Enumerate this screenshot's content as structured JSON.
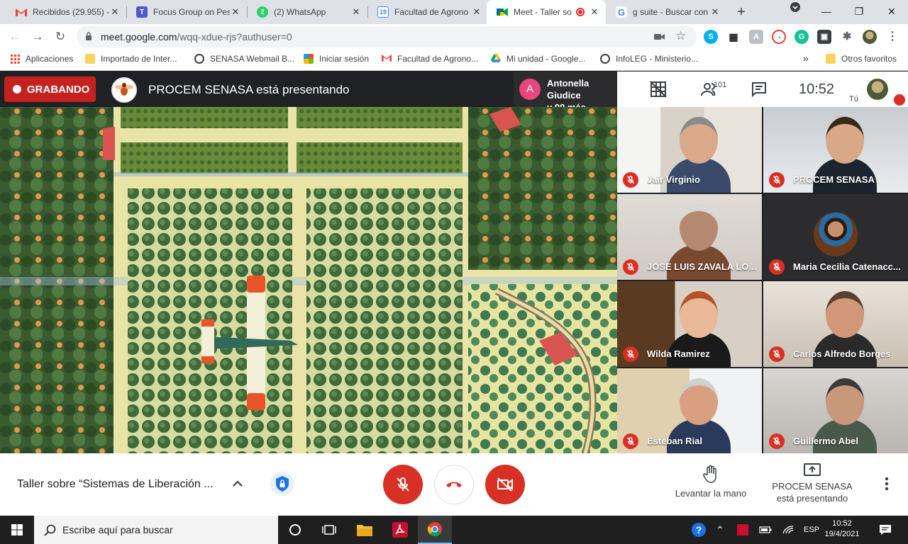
{
  "browser": {
    "tabs": [
      {
        "title": "Recibidos (29.955) - ",
        "icon": "gmail-icon"
      },
      {
        "title": "Focus Group on Pes",
        "icon": "teams-icon"
      },
      {
        "title": "(2) WhatsApp",
        "icon": "whatsapp-icon",
        "badge": "2"
      },
      {
        "title": "Facultad de Agrono",
        "icon": "calendar-icon",
        "badge": "19"
      },
      {
        "title": "Meet - Taller so",
        "icon": "meet-icon",
        "active": true
      },
      {
        "title": "g suite - Buscar con",
        "icon": "google-icon"
      }
    ],
    "url_host": "meet.google.com",
    "url_path": "/wqq-xdue-rjs?authuser=0",
    "bookmarks": [
      "Aplicaciones",
      "Importado de Inter...",
      "SENASA Webmail B...",
      "Iniciar sesión",
      "Facultad de Agrono...",
      "Mi unidad - Google...",
      "InfoLEG - Ministerio..."
    ],
    "other_bookmarks": "Otros favoritos",
    "more_bookmarks": "»"
  },
  "meet": {
    "recording_label": "GRABANDO",
    "presenting_text": "PROCEM SENASA está presentando",
    "joined_initial": "A",
    "joined_line1": "Antonella Giudice",
    "joined_line2": "y 90 más",
    "people_count": "101",
    "clock": "10:52",
    "you_label": "Tú",
    "participants": [
      {
        "name": "Jair Virginio"
      },
      {
        "name": "PROCEM SENASA"
      },
      {
        "name": "JOSE LUIS ZAVALA LO..."
      },
      {
        "name": "Maria Cecilia Catenacc..."
      },
      {
        "name": "Wilda Ramirez"
      },
      {
        "name": "Carlos Alfredo Borges"
      },
      {
        "name": "Esteban Rial"
      },
      {
        "name": "Guillermo Abel"
      }
    ],
    "meeting_title": "Taller sobre “Sistemas de Liberación ...",
    "raise_hand_label": "Levantar la mano",
    "presenting_line1": "PROCEM SENASA",
    "presenting_line2": "está presentando",
    "colors": {
      "end_call": "#d93025",
      "recording": "#c5221f",
      "mic_off": "#d93025"
    }
  },
  "taskbar": {
    "search_placeholder": "Escribe aquí para buscar",
    "language": "ESP",
    "time": "10:52",
    "date": "19/4/2021"
  }
}
